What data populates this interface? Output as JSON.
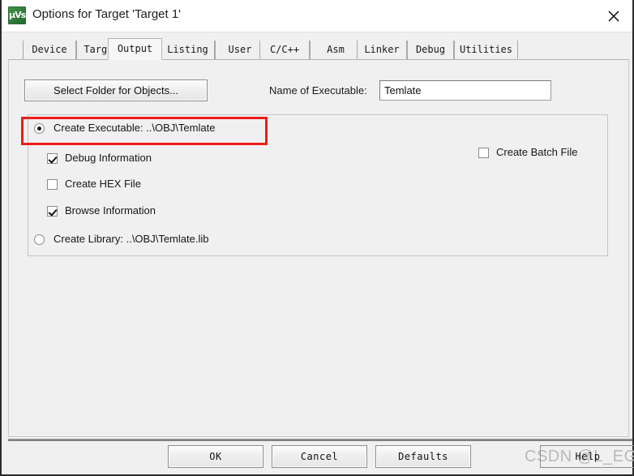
{
  "window": {
    "title": "Options for Target 'Target 1'",
    "icon": "uvision-icon",
    "close_label": "✕"
  },
  "tabs": [
    {
      "label": "Device",
      "selected": false
    },
    {
      "label": "Target",
      "selected": false
    },
    {
      "label": "Output",
      "selected": true
    },
    {
      "label": "Listing",
      "selected": false
    },
    {
      "label": "User",
      "selected": false
    },
    {
      "label": "C/C++",
      "selected": false
    },
    {
      "label": "Asm",
      "selected": false
    },
    {
      "label": "Linker",
      "selected": false
    },
    {
      "label": "Debug",
      "selected": false
    },
    {
      "label": "Utilities",
      "selected": false
    }
  ],
  "output_tab": {
    "select_folder_button": "Select Folder for Objects...",
    "exec_name_label": "Name of Executable:",
    "exec_name_value": "Temlate",
    "exec_name_placeholder": "",
    "options": {
      "create_executable": {
        "label": "Create Executable:  ..\\OBJ\\Temlate",
        "checked": true,
        "highlighted": true
      },
      "debug_information": {
        "label": "Debug Information",
        "checked": true
      },
      "create_hex_file": {
        "label": "Create HEX File",
        "checked": false
      },
      "browse_information": {
        "label": "Browse Information",
        "checked": true
      },
      "create_library": {
        "label": "Create Library:  ..\\OBJ\\Temlate.lib",
        "checked": false
      },
      "create_batch_file": {
        "label": "Create Batch File",
        "checked": false
      }
    }
  },
  "footer": {
    "ok": "OK",
    "cancel": "Cancel",
    "defaults": "Defaults",
    "help": "Help"
  },
  "watermark": {
    "text": "CSDN @L_EG"
  },
  "colors": {
    "annotation_red": "#ee1c19",
    "dialog_bg": "#f0f0f0",
    "titlebar_bg": "#ffffff",
    "icon_green": "#2f7a39"
  }
}
